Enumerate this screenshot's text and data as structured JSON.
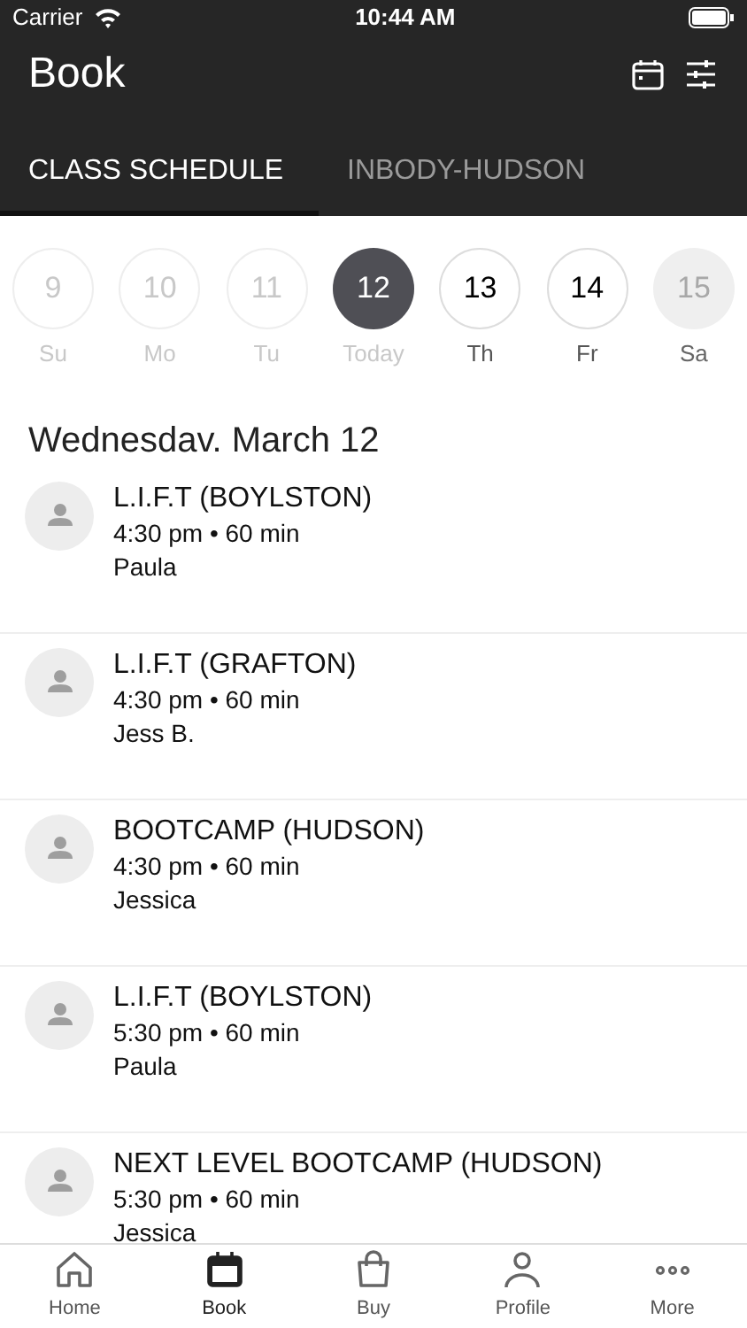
{
  "status_bar": {
    "carrier": "Carrier",
    "time": "10:44 AM"
  },
  "header": {
    "title": "Book"
  },
  "tabs": [
    {
      "label": "CLASS SCHEDULE",
      "selected": true
    },
    {
      "label": "INBODY-HUDSON",
      "selected": false
    }
  ],
  "days": [
    {
      "number": "9",
      "label": "Su",
      "kind": "past",
      "selected": false
    },
    {
      "number": "10",
      "label": "Mo",
      "kind": "past",
      "selected": false
    },
    {
      "number": "11",
      "label": "Tu",
      "kind": "past",
      "selected": false
    },
    {
      "number": "12",
      "label": "Today",
      "kind": "past",
      "selected": true
    },
    {
      "number": "13",
      "label": "Th",
      "kind": "available",
      "selected": false
    },
    {
      "number": "14",
      "label": "Fr",
      "kind": "available",
      "selected": false
    },
    {
      "number": "15",
      "label": "Sa",
      "kind": "unavailable",
      "selected": false
    }
  ],
  "date_heading": "Wednesdav. March 12",
  "classes": [
    {
      "name": "L.I.F.T (BOYLSTON)",
      "time": "4:30 pm • 60 min",
      "instructor": "Paula"
    },
    {
      "name": "L.I.F.T (GRAFTON)",
      "time": "4:30 pm • 60 min",
      "instructor": "Jess B."
    },
    {
      "name": "BOOTCAMP (HUDSON)",
      "time": "4:30 pm • 60 min",
      "instructor": "Jessica"
    },
    {
      "name": "L.I.F.T (BOYLSTON)",
      "time": "5:30 pm • 60 min",
      "instructor": "Paula"
    },
    {
      "name": "NEXT LEVEL BOOTCAMP (HUDSON)",
      "time": "5:30 pm • 60 min",
      "instructor": "Jessica"
    }
  ],
  "nav": [
    {
      "label": "Home",
      "kind": "home",
      "selected": false
    },
    {
      "label": "Book",
      "kind": "book",
      "selected": true
    },
    {
      "label": "Buy",
      "kind": "buy",
      "selected": false
    },
    {
      "label": "Profile",
      "kind": "profile",
      "selected": false
    },
    {
      "label": "More",
      "kind": "more",
      "selected": false
    }
  ]
}
